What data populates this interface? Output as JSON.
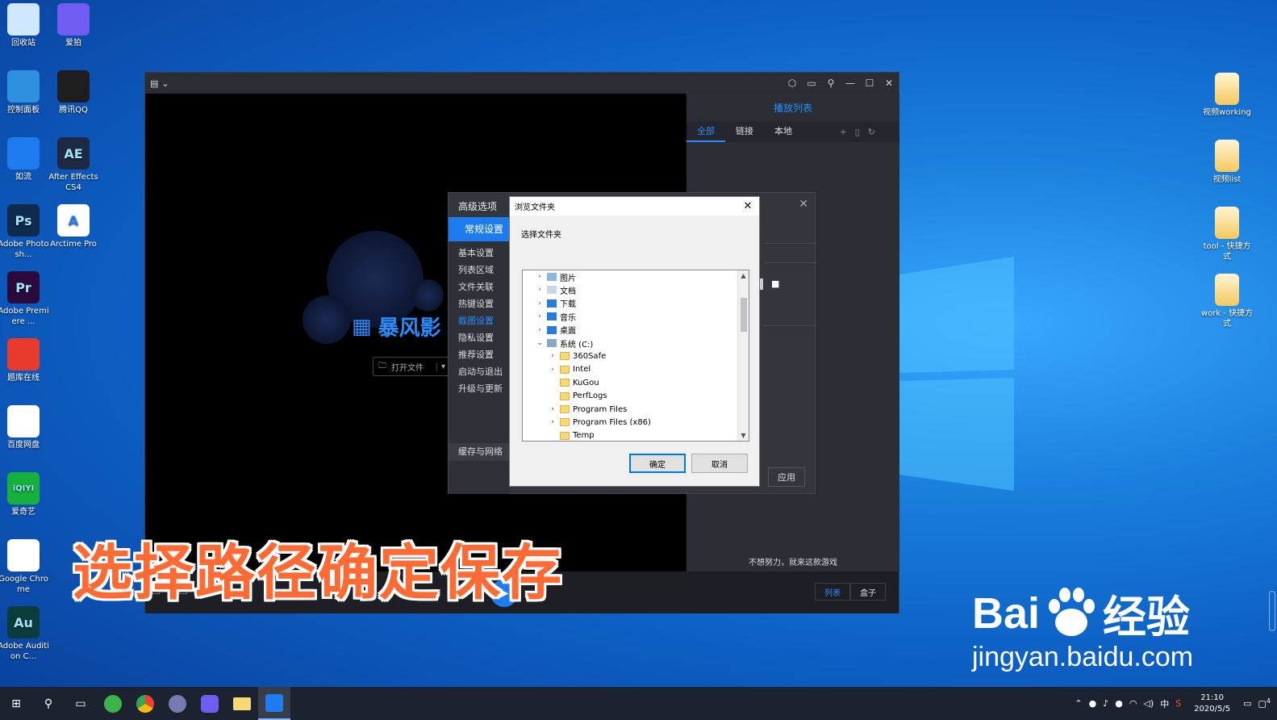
{
  "desktop_left": [
    {
      "label": "回收站",
      "icon": "recycle-bin-icon",
      "color": "#cfe7ff"
    },
    {
      "label": "爱拍",
      "icon": "aipai-icon",
      "color": "#6f5cf0"
    },
    {
      "label": "控制面板",
      "icon": "control-panel-icon",
      "color": "#2f8fe0"
    },
    {
      "label": "腾讯QQ",
      "icon": "qq-penguin-icon",
      "color": "#1e1e1e"
    },
    {
      "label": "如流",
      "icon": "ruliu-icon",
      "color": "#1e7cf0"
    },
    {
      "label": "After Effects CS4",
      "icon": "after-effects-icon",
      "color": "#1e2a44",
      "glyph": "AE"
    },
    {
      "label": "Adobe Photosh...",
      "icon": "photoshop-icon",
      "color": "#0e2a4c",
      "glyph": "Ps"
    },
    {
      "label": "Arctime Pro",
      "icon": "arctime-icon",
      "color": "#ffffff",
      "glyph": "A"
    },
    {
      "label": "Adobe Premiere ...",
      "icon": "premiere-icon",
      "color": "#2a0a3c",
      "glyph": "Pr"
    },
    {
      "label": "题库在线",
      "icon": "tiku-icon",
      "color": "#e83b2d"
    },
    {
      "label": "百度网盘",
      "icon": "baidu-netdisk-icon",
      "color": "#ffffff"
    },
    {
      "label": "爱奇艺",
      "icon": "iqiyi-icon",
      "color": "#16b13c",
      "glyph": "iQIYI"
    },
    {
      "label": "Google Chrome",
      "icon": "chrome-icon",
      "color": "#ffffff"
    },
    {
      "label": "Adobe Audition C...",
      "icon": "audition-icon",
      "color": "#0b3b3a",
      "glyph": "Au"
    }
  ],
  "desktop_right": [
    {
      "label": "视频working",
      "icon": "folder-shortcut-icon"
    },
    {
      "label": "视频list",
      "icon": "folder-shortcut-icon"
    },
    {
      "label": "tool - 快捷方式",
      "icon": "folder-shortcut-icon"
    },
    {
      "label": "work - 快捷方式",
      "icon": "folder-shortcut-icon"
    }
  ],
  "player": {
    "brand": "暴风影",
    "open_file": "打开文件",
    "playlist_title": "播放列表",
    "tabs": [
      "全部",
      "链接",
      "本地"
    ],
    "footer_text": "不想努力，就来这款游戏",
    "list_buttons": [
      "列表",
      "盒子"
    ]
  },
  "advanced": {
    "title": "高级选项",
    "group_general": "常规设置",
    "items": [
      "基本设置",
      "列表区域",
      "文件关联",
      "热键设置",
      "截图设置",
      "隐私设置",
      "推荐设置",
      "启动与退出",
      "升级与更新"
    ],
    "group_cache": "缓存与网络",
    "apply": "应用"
  },
  "browse": {
    "title": "浏览文件夹",
    "prompt": "选择文件夹",
    "tree": [
      {
        "label": "图片",
        "indent": 0,
        "expander": "›",
        "type": "pictures"
      },
      {
        "label": "文档",
        "indent": 0,
        "expander": "›",
        "type": "docs"
      },
      {
        "label": "下载",
        "indent": 0,
        "expander": "›",
        "type": "download"
      },
      {
        "label": "音乐",
        "indent": 0,
        "expander": "›",
        "type": "music"
      },
      {
        "label": "桌面",
        "indent": 0,
        "expander": "›",
        "type": "desktop"
      },
      {
        "label": "系统 (C:)",
        "indent": 0,
        "expander": "⌄",
        "type": "drive"
      },
      {
        "label": "360Safe",
        "indent": 1,
        "expander": "›",
        "type": "folder"
      },
      {
        "label": "Intel",
        "indent": 1,
        "expander": "›",
        "type": "folder"
      },
      {
        "label": "KuGou",
        "indent": 1,
        "expander": "",
        "type": "folder"
      },
      {
        "label": "PerfLogs",
        "indent": 1,
        "expander": "",
        "type": "folder"
      },
      {
        "label": "Program Files",
        "indent": 1,
        "expander": "›",
        "type": "folder"
      },
      {
        "label": "Program Files (x86)",
        "indent": 1,
        "expander": "›",
        "type": "folder"
      },
      {
        "label": "Temp",
        "indent": 1,
        "expander": "",
        "type": "folder"
      }
    ],
    "ok": "确定",
    "cancel": "取消"
  },
  "caption": "选择路径确定保存",
  "watermark": {
    "brand_left": "Bai",
    "brand_right": "经验",
    "url": "jingyan.baidu.com"
  },
  "taskbar": {
    "apps": [
      "start",
      "search",
      "task-view",
      "360-browser",
      "chrome",
      "php",
      "aipai",
      "file-explorer",
      "baofeng"
    ],
    "ime": "中",
    "time": "21:10",
    "date": "2020/5/5",
    "notifications": "4"
  }
}
